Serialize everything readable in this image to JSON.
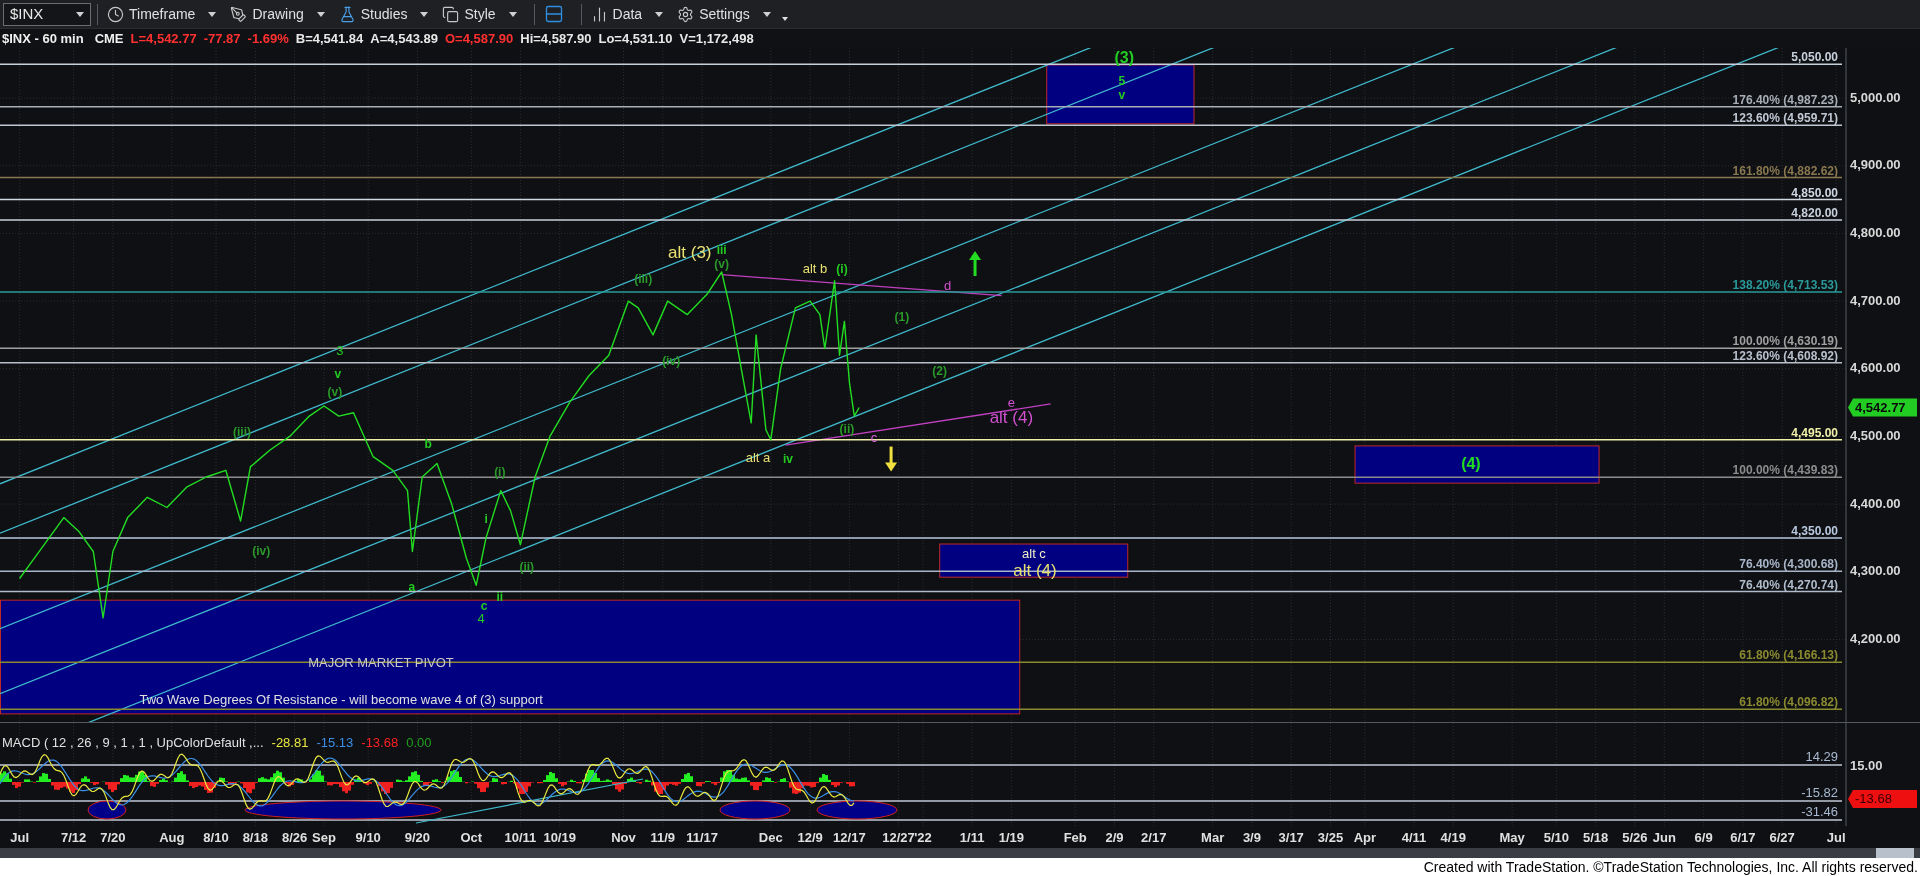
{
  "toolbar": {
    "symbol": "$INX",
    "groups": [
      [
        {
          "kind": "clock",
          "label": "Timeframe"
        },
        {
          "kind": "pen",
          "label": "Drawing"
        },
        {
          "kind": "flask",
          "label": "Studies"
        },
        {
          "kind": "style",
          "label": "Style"
        }
      ],
      [
        {
          "kind": "layout"
        }
      ],
      [
        {
          "kind": "bars",
          "label": "Data"
        },
        {
          "kind": "gear",
          "label": "Settings"
        }
      ]
    ]
  },
  "quote": {
    "title": "$INX - 60 min",
    "exchange": "CME",
    "fields": [
      {
        "text": "L=4,542.77",
        "color": "#ff3030"
      },
      {
        "text": "-77.87",
        "color": "#ff3030"
      },
      {
        "text": "-1.69%",
        "color": "#ff3030"
      },
      {
        "text": "B=4,541.84",
        "color": "#e8e8e8"
      },
      {
        "text": "A=4,543.89",
        "color": "#e8e8e8"
      },
      {
        "text": "O=4,587.90",
        "color": "#ff3030"
      },
      {
        "text": "Hi=4,587.90",
        "color": "#e8e8e8"
      },
      {
        "text": "Lo=4,531.10",
        "color": "#e8e8e8"
      },
      {
        "text": "V=1,172,498",
        "color": "#e8e8e8"
      }
    ]
  },
  "main_chart": {
    "price_axis": [
      "5,000.00",
      "4,900.00",
      "4,800.00",
      "4,700.00",
      "4,600.00",
      "4,500.00",
      "4,400.00",
      "4,300.00",
      "4,200.00"
    ],
    "last_price": "4,542.77",
    "levels": [
      {
        "label": "5,050.00",
        "color": "#c8d0dc"
      },
      {
        "label": "176.40% (4,987.23)",
        "color": "#a8aeb6"
      },
      {
        "label": "123.60% (4,959.71)",
        "color": "#c0c8d4"
      },
      {
        "label": "161.80% (4,882.62)",
        "color": "#8a7850"
      },
      {
        "label": "4,850.00",
        "color": "#d0d8e4"
      },
      {
        "label": "4,820.00",
        "color": "#c8d0dc"
      },
      {
        "label": "138.20% (4,713.53)",
        "color": "#2a9a9a"
      },
      {
        "label": "100.00% (4,630.19)",
        "color": "#a0a0a0"
      },
      {
        "label": "123.60% (4,608.92)",
        "color": "#b8c0cc"
      },
      {
        "label": "4,495.00",
        "color": "#f0f0a8"
      },
      {
        "label": "100.00% (4,439.83)",
        "color": "#8c8c8c"
      },
      {
        "label": "4,350.00",
        "color": "#b8c8e0"
      },
      {
        "label": "76.40% (4,300.68)",
        "color": "#a8b4c8"
      },
      {
        "label": "76.40% (4,270.74)",
        "color": "#b0bccc"
      },
      {
        "label": "61.80% (4,166.13)",
        "color": "#8a8a30"
      },
      {
        "label": "61.80% (4,096.82)",
        "color": "#8a8a30"
      }
    ],
    "labels": [
      {
        "text": "(3)",
        "color": "#22cc22"
      },
      {
        "text": "5",
        "color": "#22cc22"
      },
      {
        "text": "v",
        "color": "#22cc22"
      },
      {
        "text": "alt (3)",
        "color": "#e8e070"
      },
      {
        "text": "iii",
        "color": "#22cc22"
      },
      {
        "text": "(v)",
        "color": "#2a9a2a"
      },
      {
        "text": "(iii)",
        "color": "#2a9a2a"
      },
      {
        "text": "alt b",
        "color": "#e8e070"
      },
      {
        "text": "(i)",
        "color": "#22cc22"
      },
      {
        "text": "d",
        "color": "#d050d0"
      },
      {
        "text": "(1)",
        "color": "#2a9a2a"
      },
      {
        "text": "(iv)",
        "color": "#2a9a2a"
      },
      {
        "text": "(2)",
        "color": "#2a9a2a"
      },
      {
        "text": "e",
        "color": "#d050d0"
      },
      {
        "text": "alt (4)",
        "color": "#d050d0"
      },
      {
        "text": "(ii)",
        "color": "#2a9a2a"
      },
      {
        "text": "c",
        "color": "#e060e0"
      },
      {
        "text": "alt a",
        "color": "#e8e070"
      },
      {
        "text": "iv",
        "color": "#22cc22"
      },
      {
        "text": "3",
        "color": "#22cc22"
      },
      {
        "text": "v",
        "color": "#22cc22"
      },
      {
        "text": "(v)",
        "color": "#2a9a2a"
      },
      {
        "text": "(iii)",
        "color": "#2a9a2a"
      },
      {
        "text": "b",
        "color": "#22cc22"
      },
      {
        "text": "(i)",
        "color": "#2a9a2a"
      },
      {
        "text": "i",
        "color": "#22cc22"
      },
      {
        "text": "(iv)",
        "color": "#2a9a2a"
      },
      {
        "text": "(ii)",
        "color": "#2a9a2a"
      },
      {
        "text": "a",
        "color": "#22cc22"
      },
      {
        "text": "ii",
        "color": "#22cc22"
      },
      {
        "text": "c",
        "color": "#22cc22"
      },
      {
        "text": "4",
        "color": "#22cc22"
      },
      {
        "text": "alt c",
        "color": "#f0f0c8"
      },
      {
        "text": "alt (4)",
        "color": "#e8e070"
      },
      {
        "text": "(4)",
        "color": "#22dd22"
      },
      {
        "text": "MAJOR MARKET PIVOT",
        "color": "#c8c8c8"
      },
      {
        "text": "Two Wave Degrees Of Resistance - will become wave 4 of (3) support",
        "color": "#e0e0e0"
      }
    ]
  },
  "macd": {
    "title": "MACD ( 12 , 26 , 9 , 1 , 1 , UpColorDefault ,...",
    "values": [
      {
        "text": "-28.81",
        "color": "#e8e840"
      },
      {
        "text": "-15.13",
        "color": "#3a8ee6"
      },
      {
        "text": "-13.68",
        "color": "#ff2020"
      },
      {
        "text": "0.00",
        "color": "#1e9e1e"
      }
    ],
    "levels": [
      "14.29",
      "-15.82",
      "-31.46"
    ],
    "axis_tick": "15.00",
    "last_value": "-13.68"
  },
  "date_axis": [
    "Jul",
    "7/12",
    "7/20",
    "Aug",
    "8/10",
    "8/18",
    "8/26",
    "Sep",
    "9/10",
    "9/20",
    "Oct",
    "10/11",
    "10/19",
    "Nov",
    "11/9",
    "11/17",
    "Dec",
    "12/9",
    "12/17",
    "12/27",
    "'22",
    "1/11",
    "1/19",
    "Feb",
    "2/9",
    "2/17",
    "Mar",
    "3/9",
    "3/17",
    "3/25",
    "Apr",
    "4/11",
    "4/19",
    "May",
    "5/10",
    "5/18",
    "5/26",
    "Jun",
    "6/9",
    "6/17",
    "6/27",
    "Jul"
  ],
  "footer": "Created with TradeStation. ©TradeStation Technologies, Inc. All rights reserved."
}
